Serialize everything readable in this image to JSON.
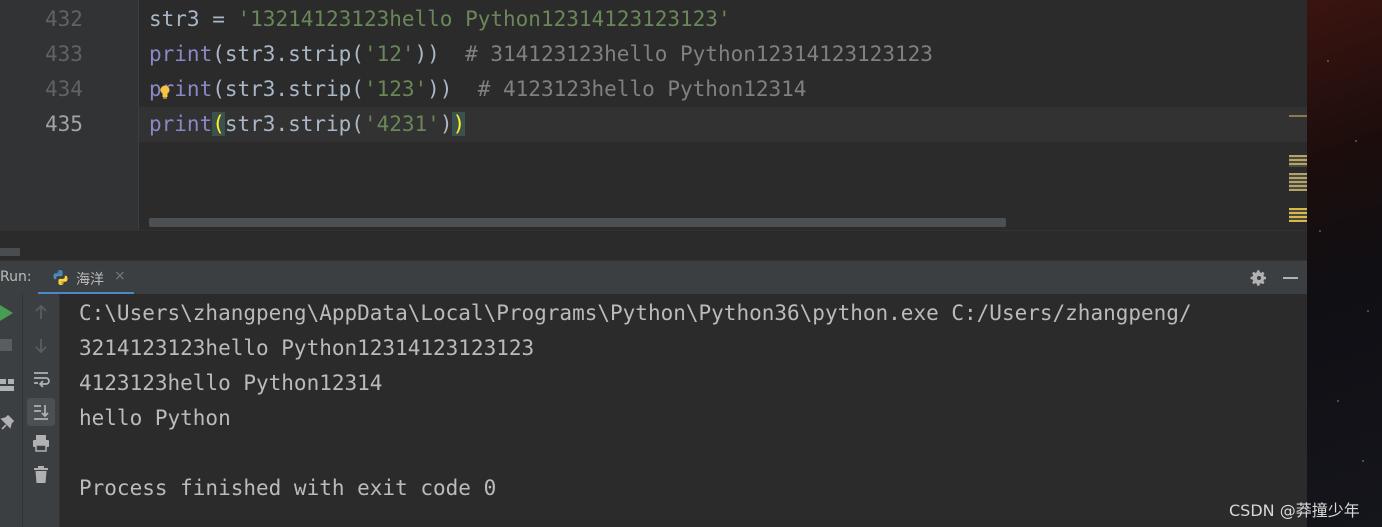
{
  "editor": {
    "lines": [
      {
        "number": "432",
        "parts": [
          {
            "text": "str3 = ",
            "cls": ""
          },
          {
            "text": "'13214123123hello Python12314123123123'",
            "cls": "str"
          }
        ]
      },
      {
        "number": "433",
        "parts": [
          {
            "text": "print",
            "cls": "fn"
          },
          {
            "text": "(str3.strip(",
            "cls": ""
          },
          {
            "text": "'12'",
            "cls": "str"
          },
          {
            "text": "))  ",
            "cls": ""
          },
          {
            "text": "# 314123123hello Python12314123123123",
            "cls": "cmt"
          }
        ]
      },
      {
        "number": "434",
        "parts": [
          {
            "text": "print",
            "cls": "fn"
          },
          {
            "text": "(str3.strip(",
            "cls": ""
          },
          {
            "text": "'123'",
            "cls": "str"
          },
          {
            "text": "))  ",
            "cls": ""
          },
          {
            "text": "# 4123123hello Python12314",
            "cls": "cmt"
          }
        ]
      },
      {
        "number": "435",
        "parts": [
          {
            "text": "print",
            "cls": "fn"
          },
          {
            "text": "(",
            "cls": "brace-hl"
          },
          {
            "text": "str3.strip(",
            "cls": ""
          },
          {
            "text": "'4231'",
            "cls": "str"
          },
          {
            "text": ")",
            "cls": ""
          },
          {
            "text": ")",
            "cls": "brace-hl"
          }
        ]
      }
    ]
  },
  "run": {
    "label": "Run:",
    "tab_label": "海洋",
    "tab_close": "×"
  },
  "console": {
    "lines": [
      "C:\\Users\\zhangpeng\\AppData\\Local\\Programs\\Python\\Python36\\python.exe C:/Users/zhangpeng/",
      "3214123123hello Python12314123123123",
      "4123123hello Python12314",
      "hello Python",
      "",
      "Process finished with exit code 0"
    ]
  },
  "watermark": "CSDN @莽撞少年",
  "colors": {
    "string": "#6a8759",
    "builtin": "#8888c6",
    "comment": "#808080",
    "text": "#a9b7c6",
    "console_text": "#bbbbbb"
  }
}
